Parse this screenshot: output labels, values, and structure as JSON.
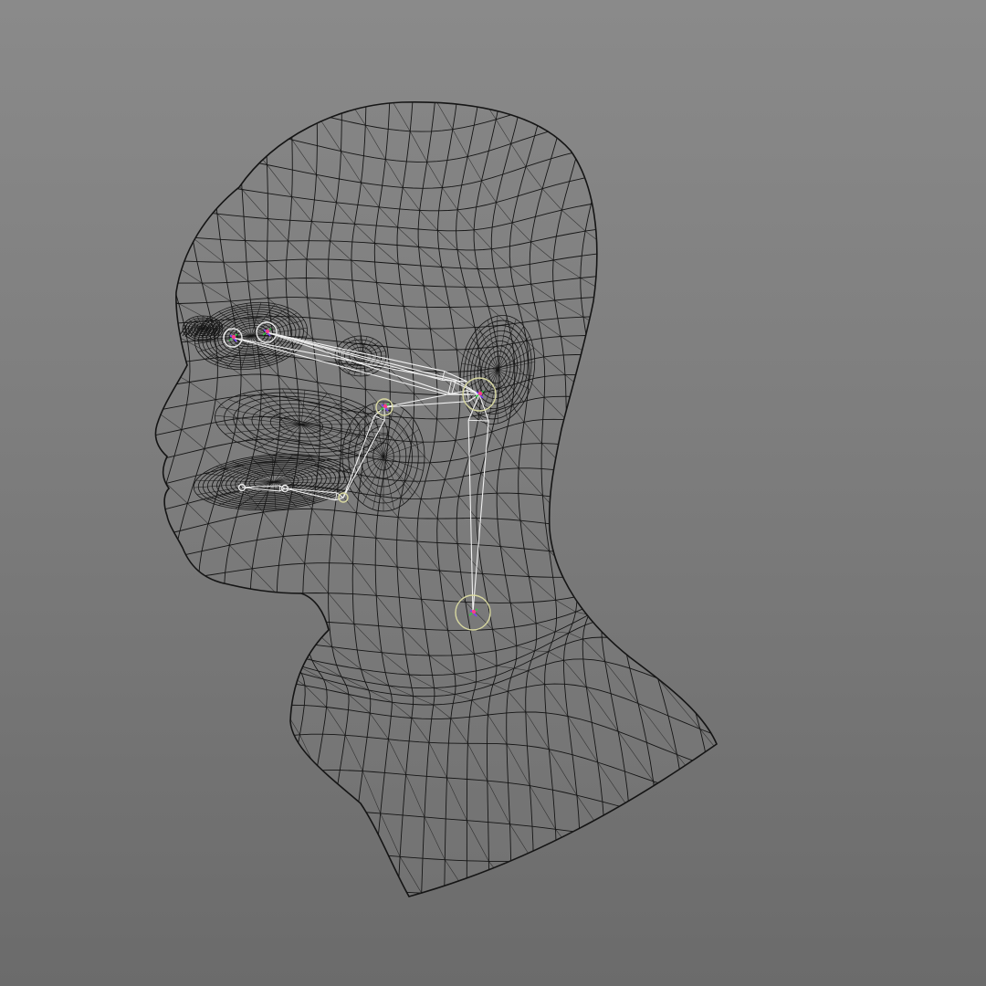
{
  "viewport": {
    "background_top": "#8a8a8a",
    "background_bottom": "#6b6b6b",
    "wire_color": "#151515",
    "rig_color": "#f2f2f2",
    "joint_ring_color": "#d8d8a0",
    "gizmo_colors": [
      "#2ecc40",
      "#7a3cff",
      "#ff3c8a"
    ]
  },
  "model": {
    "kind": "wireframe-head",
    "rig": {
      "joints": [
        "left-eye",
        "right-eye",
        "ear",
        "cheek",
        "jaw",
        "mouth-left",
        "mouth-right",
        "neck"
      ]
    }
  }
}
